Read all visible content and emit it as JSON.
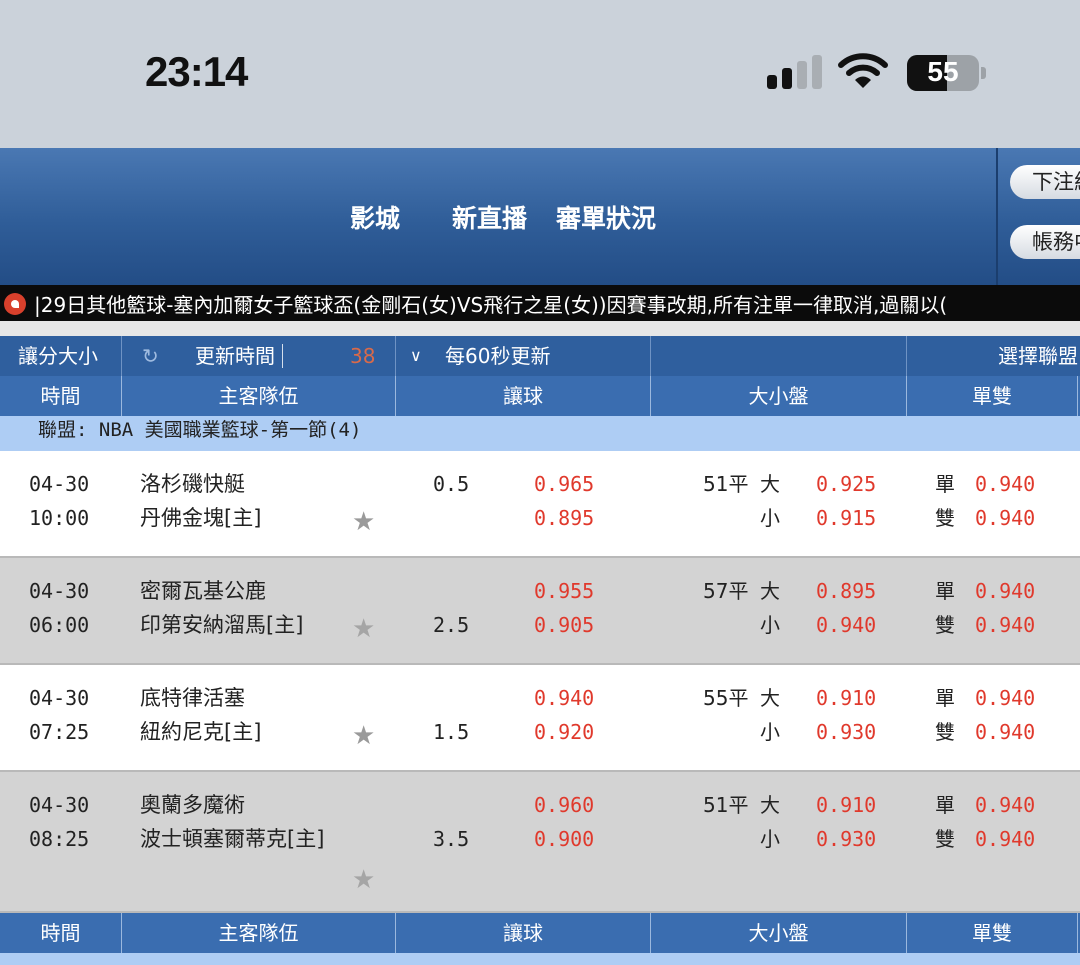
{
  "status_bar": {
    "time": "23:14",
    "battery": "55",
    "battery_level": 0.55
  },
  "header": {
    "nav": [
      "影城",
      "新直播",
      "審單狀況"
    ],
    "buttons": [
      "下注紀錄",
      "帳務中心"
    ]
  },
  "ticker": {
    "text": "29日其他籃球-塞內加爾女子籃球盃(金剛石(女)VS飛行之星(女))因賽事改期,所有注單一律取消,過關以("
  },
  "toolbar": {
    "bet_type": "讓分大小",
    "refresh_label": "更新時間",
    "countdown": "38",
    "interval": "每60秒更新",
    "select_league": "選擇聯盟"
  },
  "columns": [
    "時間",
    "主客隊伍",
    "讓球",
    "大小盤",
    "單雙"
  ],
  "league": {
    "label": "聯盟: NBA 美國職業籃球-第一節(4)"
  },
  "matches": [
    {
      "date": "04-30",
      "time": "10:00",
      "home": "洛杉磯快艇",
      "away": "丹佛金塊[主]",
      "hcp_line_top": "0.5",
      "hcp_line_bottom": "",
      "hcp_odds_top": "0.965",
      "hcp_odds_bottom": "0.895",
      "ou_line": "51平",
      "over_label": "大",
      "under_label": "小",
      "over_odds": "0.925",
      "under_odds": "0.915",
      "odd_label": "單",
      "even_label": "雙",
      "odd_odds": "0.940",
      "even_odds": "0.940"
    },
    {
      "date": "04-30",
      "time": "06:00",
      "home": "密爾瓦基公鹿",
      "away": "印第安納溜馬[主]",
      "hcp_line_top": "",
      "hcp_line_bottom": "2.5",
      "hcp_odds_top": "0.955",
      "hcp_odds_bottom": "0.905",
      "ou_line": "57平",
      "over_label": "大",
      "under_label": "小",
      "over_odds": "0.895",
      "under_odds": "0.940",
      "odd_label": "單",
      "even_label": "雙",
      "odd_odds": "0.940",
      "even_odds": "0.940"
    },
    {
      "date": "04-30",
      "time": "07:25",
      "home": "底特律活塞",
      "away": "紐約尼克[主]",
      "hcp_line_top": "",
      "hcp_line_bottom": "1.5",
      "hcp_odds_top": "0.940",
      "hcp_odds_bottom": "0.920",
      "ou_line": "55平",
      "over_label": "大",
      "under_label": "小",
      "over_odds": "0.910",
      "under_odds": "0.930",
      "odd_label": "單",
      "even_label": "雙",
      "odd_odds": "0.940",
      "even_odds": "0.940"
    },
    {
      "date": "04-30",
      "time": "08:25",
      "home": "奧蘭多魔術",
      "away": "波士頓塞爾蒂克[主]",
      "hcp_line_top": "",
      "hcp_line_bottom": "3.5",
      "hcp_odds_top": "0.960",
      "hcp_odds_bottom": "0.900",
      "ou_line": "51平",
      "over_label": "大",
      "under_label": "小",
      "over_odds": "0.910",
      "under_odds": "0.930",
      "odd_label": "單",
      "even_label": "雙",
      "odd_odds": "0.940",
      "even_odds": "0.940"
    }
  ],
  "icons": {
    "refresh": "refresh-icon",
    "dropdown": "chevron-down-icon",
    "favorite": "star-icon",
    "ticker": "megaphone-icon"
  },
  "colors": {
    "header": "#2f5d98",
    "odds": "#e0392c",
    "league_bar": "#aecdf4"
  }
}
